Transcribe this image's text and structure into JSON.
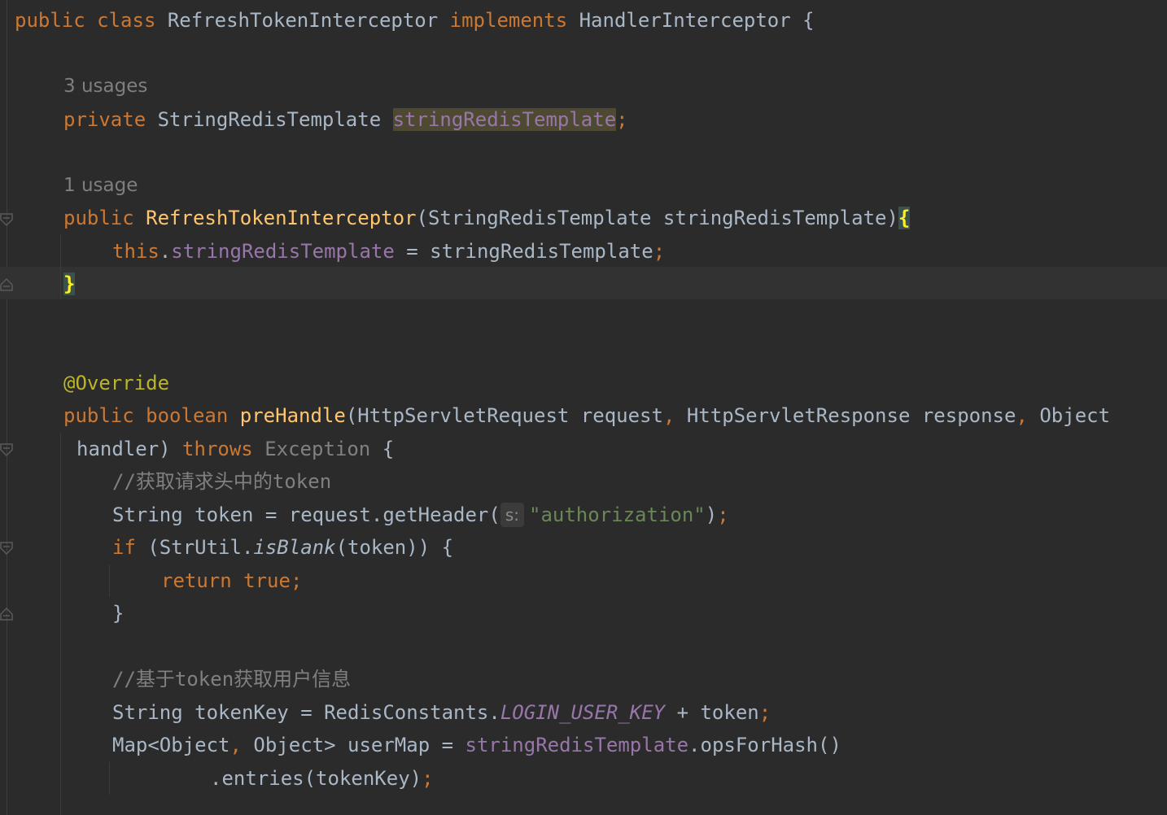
{
  "editor": {
    "theme_colors": {
      "background": "#2b2b2b",
      "keyword": "#cc7832",
      "method": "#ffc66d",
      "field": "#9876aa",
      "string": "#6a8759",
      "comment": "#808080",
      "annotation": "#bbb529",
      "text": "#a9b7c6"
    },
    "class_decl": {
      "kw_public": "public",
      "kw_class": "class",
      "name": "RefreshTokenInterceptor",
      "kw_implements": "implements",
      "iface": "HandlerInterceptor",
      "open": " {"
    },
    "usages_field": "3 usages",
    "field_decl": {
      "kw": "private",
      "type": "StringRedisTemplate",
      "name": "stringRedisTemplate",
      "semi": ";"
    },
    "usages_ctor": "1 usage",
    "ctor_decl": {
      "kw": "public",
      "name": "RefreshTokenInterceptor",
      "params": "(StringRedisTemplate stringRedisTemplate)",
      "open": "{"
    },
    "ctor_body": {
      "kw_this": "this",
      "dot": ".",
      "field": "stringRedisTemplate",
      "assign": " = stringRedisTemplate",
      "semi": ";"
    },
    "ctor_close": "}",
    "annotation": "@Override",
    "method_decl": {
      "kw_public": "public",
      "kw_boolean": "boolean",
      "name": "preHandle",
      "params_part1": "(HttpServletRequest request",
      "comma1": ",",
      "params_part2": " HttpServletResponse response",
      "comma2": ",",
      "params_part3": " Object",
      "params_cont": "handler) ",
      "kw_throws": "throws",
      "exception": "Exception",
      "open": " {"
    },
    "comment1": "//获取请求头中的token",
    "get_header": {
      "prefix": "String token = request.getHeader(",
      "param_hint": "s:",
      "string": "\"authorization\"",
      "suffix": ")",
      "semi": ";"
    },
    "if_stmt": {
      "kw_if": "if",
      "cond_a": " (StrUtil.",
      "call": "isBlank",
      "cond_b": "(token)) {"
    },
    "return_stmt": {
      "kw_return": "return",
      "kw_true": "true",
      "semi": ";"
    },
    "if_close": "}",
    "comment2": "//基于token获取用户信息",
    "token_key": {
      "prefix": "String tokenKey = RedisConstants.",
      "constant": "LOGIN_USER_KEY",
      "suffix": " + token",
      "semi": ";"
    },
    "user_map": {
      "prefix": "Map<Object",
      "comma": ",",
      "mid": " Object> userMap = ",
      "field": "stringRedisTemplate",
      "suffix": ".opsForHash()"
    },
    "entries": {
      "text": ".entries(tokenKey)",
      "semi": ";"
    }
  }
}
